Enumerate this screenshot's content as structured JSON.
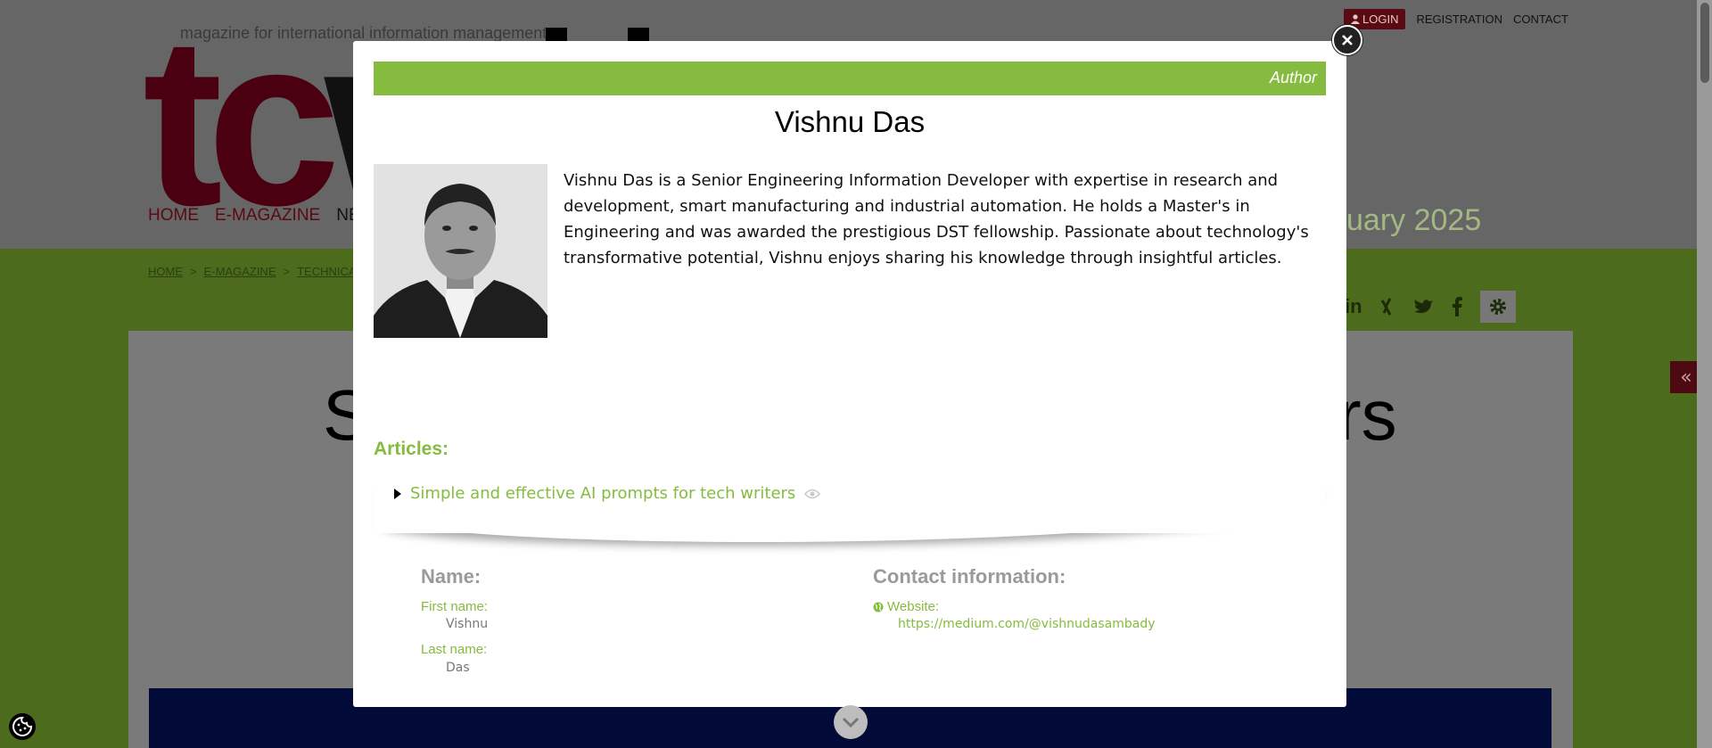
{
  "header": {
    "logo_tagline": "magazine for international information management",
    "logo_letters_left": "tc",
    "logo_letters_right": "w",
    "top_nav": {
      "login": "LOGIN",
      "registration": "REGISTRATION",
      "contact": "CONTACT"
    },
    "main_nav": {
      "home": "HOME",
      "emagazine": "E-MAGAZINE",
      "news_partial": "NE"
    },
    "issue_partial": "uary 2025"
  },
  "breadcrumb": {
    "home": "HOME",
    "emagazine": "E-MAGAZINE",
    "section_partial": "TECHNICAL W"
  },
  "article_title_partial": {
    "left": "S",
    "right": "rs"
  },
  "modal": {
    "bar_label": "Author",
    "name": "Vishnu Das",
    "bio": "Vishnu Das is a Senior Engineering Information Developer with expertise in research and development, smart manufacturing and industrial automation. He holds a Master's in Engineering and was awarded the prestigious DST fellowship. Passionate about technology's transformative potential, Vishnu enjoys sharing his knowledge through insightful articles.",
    "articles_heading": "Articles:",
    "articles": [
      {
        "title": "Simple and effective AI prompts for tech writers"
      }
    ],
    "name_section": {
      "heading": "Name:",
      "first_label": "First name:",
      "first_value": "Vishnu",
      "last_label": "Last name:",
      "last_value": "Das"
    },
    "contact_section": {
      "heading": "Contact information:",
      "website_label": "Website:",
      "website_value": "https://medium.com/@vishnudasambady"
    }
  },
  "colors": {
    "accent_green": "#85bc3f",
    "brand_red": "#a8001e",
    "overlay": "rgba(0,0,0,0.6)"
  },
  "icons": [
    "close-icon",
    "user-icon",
    "linkedin-icon",
    "xing-icon",
    "twitter-icon",
    "facebook-icon",
    "gear-icon",
    "double-chevron-left-icon",
    "play-triangle-icon",
    "eye-icon",
    "globe-icon",
    "chevron-down-icon",
    "cookie-icon"
  ]
}
